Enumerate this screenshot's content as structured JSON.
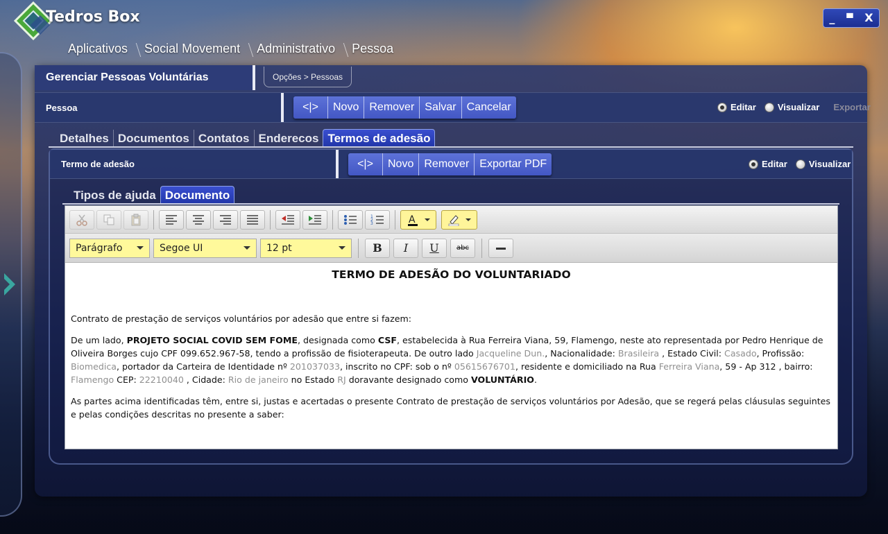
{
  "app": {
    "title": "Tedros Box"
  },
  "window_controls": {
    "minimize": "_",
    "maximize": "▀",
    "close": "X"
  },
  "breadcrumb": [
    "Aplicativos",
    "Social Movement",
    "Administrativo",
    "Pessoa"
  ],
  "panel": {
    "title": "Gerenciar Pessoas Voluntárias",
    "crumbs": "Opções > Pessoas"
  },
  "pessoa_bar": {
    "label": "Pessoa",
    "buttons": [
      "<|>",
      "Novo",
      "Remover",
      "Salvar",
      "Cancelar"
    ],
    "mode": {
      "editar": "Editar",
      "visualizar": "Visualizar",
      "exportar": "Exportar",
      "selected": "editar"
    }
  },
  "tabs": {
    "items": [
      "Detalhes",
      "Documentos",
      "Contatos",
      "Enderecos",
      "Termos de adesão"
    ],
    "active": "Termos de adesão"
  },
  "termo_bar": {
    "label": "Termo de adesão",
    "buttons": [
      "<|>",
      "Novo",
      "Remover",
      "Exportar PDF"
    ],
    "mode": {
      "editar": "Editar",
      "visualizar": "Visualizar",
      "selected": "editar"
    }
  },
  "subtabs": {
    "items": [
      "Tipos de ajuda",
      "Documento"
    ],
    "active": "Documento"
  },
  "editor": {
    "paragraph_style": "Parágrafo",
    "font_family": "Segoe UI",
    "font_size": "12 pt",
    "icons": [
      "cut-icon",
      "copy-icon",
      "paste-icon",
      "align-left-icon",
      "align-center-icon",
      "align-right-icon",
      "justify-icon",
      "outdent-icon",
      "indent-icon",
      "bullet-list-icon",
      "numbered-list-icon",
      "font-color-icon",
      "highlight-icon"
    ],
    "format_buttons": {
      "bold": "B",
      "italic": "I",
      "underline": "U",
      "strike": "abc"
    },
    "colors": {
      "dropdown_bg": "#fff99b",
      "field_value": "#8f8f8f",
      "button": "#4f63cf"
    }
  },
  "document": {
    "title": "TERMO DE ADESÃO DO VOLUNTARIADO",
    "intro": "Contrato de prestação de serviços voluntários por adesão que entre si fazem:",
    "p1": {
      "t1": "De um lado, ",
      "org": "PROJETO SOCIAL COVID SEM FOME",
      "t2": ", designada como ",
      "org_short": "CSF",
      "t3": ", estabelecida à Rua Ferreira Viana, 59, Flamengo, neste ato representada por Pedro Henrique de Oliveira Borges cujo CPF 099.652.967-58, tendo a profissão de fisioterapeuta. De outro lado ",
      "nome": "Jacqueline Dun.",
      "t4": ", Nacionalidade: ",
      "nacionalidade": "Brasileira",
      "t5": " , Estado Civil: ",
      "estado_civil": "Casado",
      "t6": ", Profissão: ",
      "profissao": "Biomedica",
      "t7": ", portador da Carteira de Identidade nº ",
      "identidade": "201037033",
      "t8": ", inscrito no CPF: sob o nº ",
      "cpf": "05615676701",
      "t9": ", residente e domiciliado na Rua ",
      "rua": "Ferreira Viana",
      "t10": ", 59 - Ap 312 , bairro: ",
      "bairro": "Flamengo",
      "t11": " CEP: ",
      "cep": "22210040",
      "t12": " , Cidade: ",
      "cidade": "Rio de janeiro",
      "t13": " no Estado ",
      "estado": "RJ",
      "t14": " doravante designado como ",
      "designado": "VOLUNTÁRIO",
      "t15": "."
    },
    "p2": "As partes acima identificadas têm, entre si, justas e acertadas o presente Contrato de prestação de serviços voluntários por Adesão, que se regerá pelas cláusulas seguintes e pelas condições descritas no presente a saber:"
  }
}
